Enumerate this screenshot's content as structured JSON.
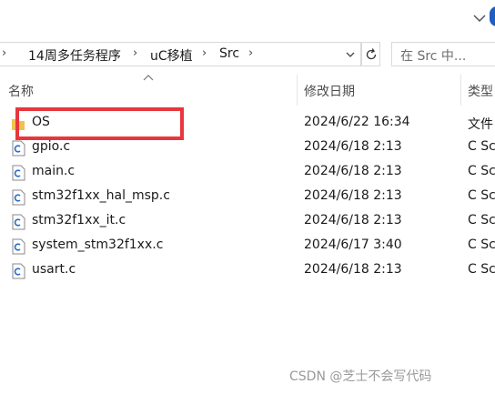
{
  "address": {
    "crumbs": [
      "14周多任务程序",
      "uC移植",
      "Src"
    ],
    "lead_sep": "›"
  },
  "search": {
    "placeholder": "在 Src 中..."
  },
  "columns": {
    "name": "名称",
    "date": "修改日期",
    "type": "类型"
  },
  "files": [
    {
      "name": "OS",
      "date": "2024/6/22 16:34",
      "type": "文件",
      "icon": "folder-icon"
    },
    {
      "name": "gpio.c",
      "date": "2024/6/18 2:13",
      "type": "C Sc",
      "icon": "c-file-icon"
    },
    {
      "name": "main.c",
      "date": "2024/6/18 2:13",
      "type": "C Sc",
      "icon": "c-file-icon"
    },
    {
      "name": "stm32f1xx_hal_msp.c",
      "date": "2024/6/18 2:13",
      "type": "C Sc",
      "icon": "c-file-icon"
    },
    {
      "name": "stm32f1xx_it.c",
      "date": "2024/6/18 2:13",
      "type": "C Sc",
      "icon": "c-file-icon"
    },
    {
      "name": "system_stm32f1xx.c",
      "date": "2024/6/17 3:40",
      "type": "C Sc",
      "icon": "c-file-icon"
    },
    {
      "name": "usart.c",
      "date": "2024/6/18 2:13",
      "type": "C Sc",
      "icon": "c-file-icon"
    }
  ],
  "watermark": "CSDN @芝士不会写代码",
  "colors": {
    "highlight": "#e8363d",
    "folder": "#f2c14e",
    "accent": "#1f5fbf"
  }
}
